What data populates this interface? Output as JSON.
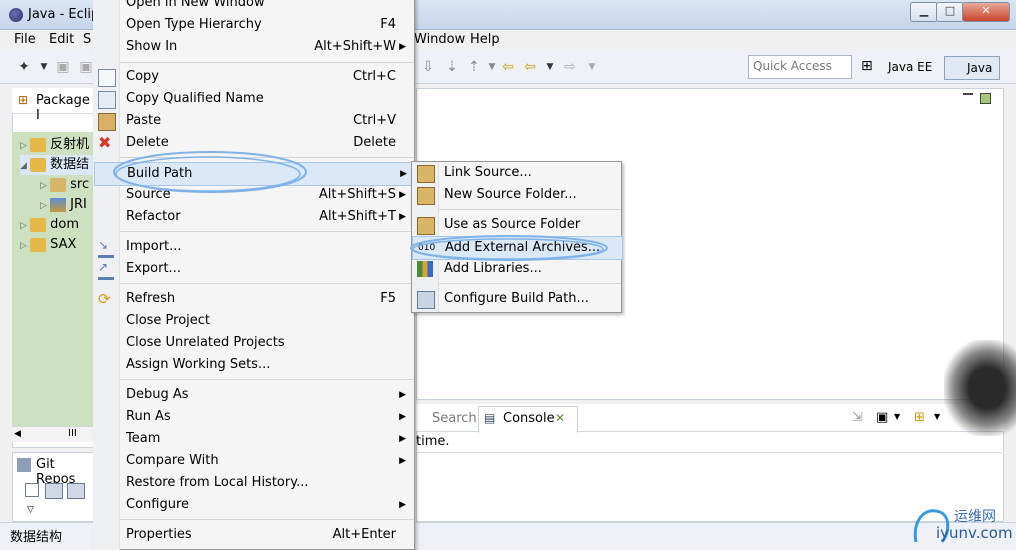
{
  "window": {
    "title": "Java - Eclip",
    "controls": {
      "minimize": "▁",
      "maximize": "□",
      "close": "✕"
    }
  },
  "menubar": {
    "items": [
      "File",
      "Edit",
      "S",
      "Window",
      "Help"
    ]
  },
  "toolbar": {
    "quick_access_placeholder": "Quick Access",
    "perspectives": [
      "Java EE",
      "Java"
    ]
  },
  "package_explorer": {
    "tab_label": "Package I",
    "tree": [
      {
        "label": "反射机",
        "level": 0,
        "expanded": false
      },
      {
        "label": "数据结",
        "level": 0,
        "expanded": true
      },
      {
        "label": "src",
        "level": 1,
        "expanded": false
      },
      {
        "label": "JRI",
        "level": 1,
        "expanded": false
      },
      {
        "label": "dom",
        "level": 0,
        "expanded": false
      },
      {
        "label": "SAX",
        "level": 0,
        "expanded": false
      }
    ],
    "scroll_label": "III"
  },
  "git_panel": {
    "tab_label": "Git Repos"
  },
  "status_bar": {
    "text": "数据结构"
  },
  "console": {
    "tabs": [
      "Search",
      "Console"
    ],
    "content": "time."
  },
  "context_menu": {
    "items": [
      {
        "label": "Open in New Window",
        "accelerator": "",
        "submenu": false,
        "icon": ""
      },
      {
        "label": "Open Type Hierarchy",
        "accelerator": "F4",
        "submenu": false,
        "icon": ""
      },
      {
        "label": "Show In",
        "accelerator": "Alt+Shift+W",
        "submenu": true,
        "icon": ""
      },
      {
        "label": "Copy",
        "accelerator": "Ctrl+C",
        "submenu": false,
        "icon": "copy-icon"
      },
      {
        "label": "Copy Qualified Name",
        "accelerator": "",
        "submenu": false,
        "icon": "copy-qualified-icon"
      },
      {
        "label": "Paste",
        "accelerator": "Ctrl+V",
        "submenu": false,
        "icon": "paste-icon"
      },
      {
        "label": "Delete",
        "accelerator": "Delete",
        "submenu": false,
        "icon": "delete-icon"
      },
      {
        "label": "Build Path",
        "accelerator": "",
        "submenu": true,
        "icon": "",
        "highlighted": true
      },
      {
        "label": "Source",
        "accelerator": "Alt+Shift+S",
        "submenu": true,
        "icon": ""
      },
      {
        "label": "Refactor",
        "accelerator": "Alt+Shift+T",
        "submenu": true,
        "icon": ""
      },
      {
        "label": "Import...",
        "accelerator": "",
        "submenu": false,
        "icon": "import-icon"
      },
      {
        "label": "Export...",
        "accelerator": "",
        "submenu": false,
        "icon": "export-icon"
      },
      {
        "label": "Refresh",
        "accelerator": "F5",
        "submenu": false,
        "icon": "refresh-icon"
      },
      {
        "label": "Close Project",
        "accelerator": "",
        "submenu": false,
        "icon": ""
      },
      {
        "label": "Close Unrelated Projects",
        "accelerator": "",
        "submenu": false,
        "icon": ""
      },
      {
        "label": "Assign Working Sets...",
        "accelerator": "",
        "submenu": false,
        "icon": ""
      },
      {
        "label": "Debug As",
        "accelerator": "",
        "submenu": true,
        "icon": ""
      },
      {
        "label": "Run As",
        "accelerator": "",
        "submenu": true,
        "icon": ""
      },
      {
        "label": "Team",
        "accelerator": "",
        "submenu": true,
        "icon": ""
      },
      {
        "label": "Compare With",
        "accelerator": "",
        "submenu": true,
        "icon": ""
      },
      {
        "label": "Restore from Local History...",
        "accelerator": "",
        "submenu": false,
        "icon": ""
      },
      {
        "label": "Configure",
        "accelerator": "",
        "submenu": true,
        "icon": ""
      },
      {
        "label": "Properties",
        "accelerator": "Alt+Enter",
        "submenu": false,
        "icon": ""
      }
    ]
  },
  "build_path_submenu": {
    "items": [
      {
        "label": "Link Source...",
        "icon": "link-source-icon"
      },
      {
        "label": "New Source Folder...",
        "icon": "new-source-folder-icon"
      },
      {
        "label": "Use as Source Folder",
        "icon": "use-source-folder-icon"
      },
      {
        "label": "Add External Archives...",
        "icon": "jar-archive-icon",
        "highlighted": true
      },
      {
        "label": "Add Libraries...",
        "icon": "libraries-icon"
      },
      {
        "label": "Configure Build Path...",
        "icon": "configure-build-path-icon"
      }
    ]
  },
  "watermark": {
    "text": "运维网",
    "subtext": "iyunv.com"
  },
  "colors": {
    "menu_highlight": "#dbe8f7",
    "annotation_circle": "#7fb3e8",
    "tree_background": "#cde0c0"
  }
}
